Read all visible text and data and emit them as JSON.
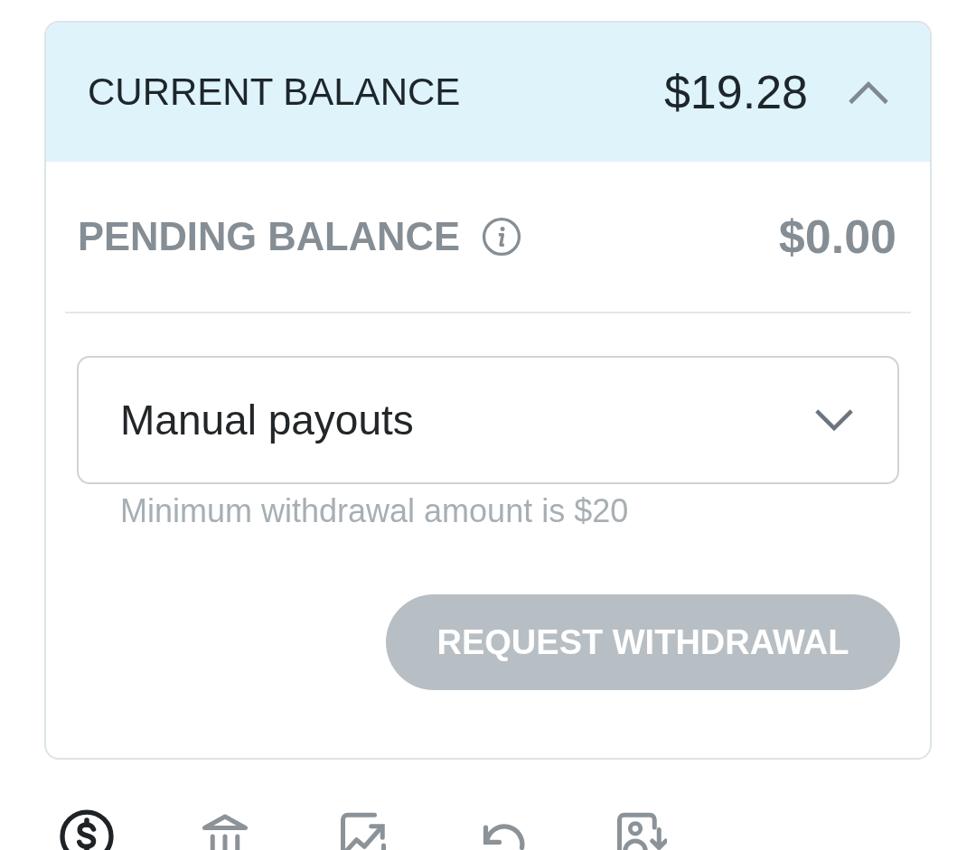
{
  "balance_card": {
    "header": {
      "label": "CURRENT BALANCE",
      "amount": "$19.28",
      "expanded": true
    },
    "pending": {
      "label": "PENDING BALANCE",
      "amount": "$0.00"
    },
    "payout_method": {
      "value": "Manual payouts",
      "helper": "Minimum withdrawal amount is $20"
    },
    "withdraw_button": {
      "label": "REQUEST WITHDRAWAL",
      "disabled": true
    }
  },
  "bottom_nav": [
    {
      "selected": true
    },
    {
      "selected": false
    },
    {
      "selected": false
    },
    {
      "selected": false
    },
    {
      "selected": false
    }
  ]
}
